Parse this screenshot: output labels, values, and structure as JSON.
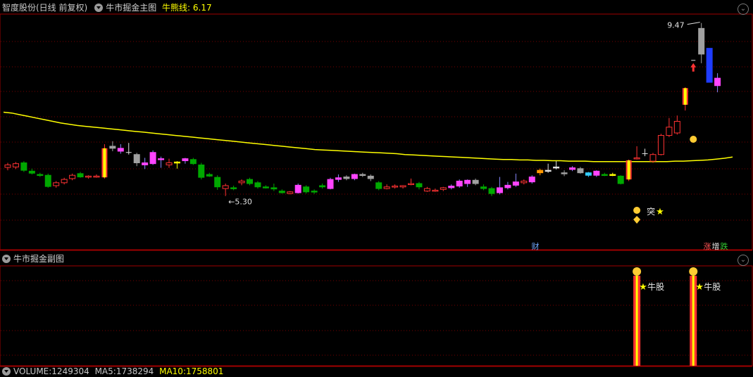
{
  "main": {
    "stock_name": "智度股份(日线 前复权)",
    "indicator_name": "牛市掘金主图",
    "line_label": "牛熊线:",
    "line_value": "6.17",
    "high_label": "9.47",
    "low_label": "5.30",
    "breakout_label": "突",
    "finance_marker": "财",
    "limit_markers": [
      "涨",
      "增",
      "跌"
    ]
  },
  "sub": {
    "indicator_name": "牛市掘金副图",
    "signal_label": "牛股"
  },
  "volume": {
    "label": "VOLUME:",
    "value": "1249304",
    "ma5_label": "MA5:",
    "ma5_value": "1738294",
    "ma10_label": "MA10:",
    "ma10_value": "1758801"
  },
  "colors": {
    "up": "#ff3232",
    "down": "#00a800",
    "magenta": "#ff44ff",
    "gray": "#a0a0a0",
    "line": "#ffff00",
    "accent": "#ffff00"
  },
  "chart_data": {
    "type": "candlestick",
    "price_axis": {
      "min": 4.6,
      "max": 9.6
    },
    "bull_bear_line_value": 6.17,
    "annotated_high": 9.47,
    "annotated_low": 5.3,
    "candles": [
      {
        "o": 5.99,
        "h": 6.1,
        "l": 5.92,
        "c": 6.05,
        "k": "up"
      },
      {
        "o": 6.0,
        "h": 6.12,
        "l": 5.95,
        "c": 6.08,
        "k": "up"
      },
      {
        "o": 6.1,
        "h": 6.14,
        "l": 5.88,
        "c": 5.92,
        "k": "down"
      },
      {
        "o": 5.9,
        "h": 5.96,
        "l": 5.82,
        "c": 5.85,
        "k": "down"
      },
      {
        "o": 5.82,
        "h": 5.86,
        "l": 5.76,
        "c": 5.8,
        "k": "down"
      },
      {
        "o": 5.8,
        "h": 5.84,
        "l": 5.5,
        "c": 5.53,
        "k": "down"
      },
      {
        "o": 5.55,
        "h": 5.66,
        "l": 5.5,
        "c": 5.62,
        "k": "up"
      },
      {
        "o": 5.62,
        "h": 5.74,
        "l": 5.58,
        "c": 5.7,
        "k": "up"
      },
      {
        "o": 5.72,
        "h": 5.84,
        "l": 5.68,
        "c": 5.8,
        "k": "up"
      },
      {
        "o": 5.84,
        "h": 5.88,
        "l": 5.74,
        "c": 5.76,
        "k": "down"
      },
      {
        "o": 5.76,
        "h": 5.8,
        "l": 5.72,
        "c": 5.78,
        "k": "up"
      },
      {
        "o": 5.78,
        "h": 5.82,
        "l": 5.74,
        "c": 5.76,
        "k": "up"
      },
      {
        "o": 5.75,
        "h": 6.55,
        "l": 5.72,
        "c": 6.45,
        "k": "special"
      },
      {
        "o": 6.45,
        "h": 6.62,
        "l": 6.38,
        "c": 6.5,
        "k": "gray"
      },
      {
        "o": 6.45,
        "h": 6.55,
        "l": 6.32,
        "c": 6.38,
        "k": "magenta"
      },
      {
        "o": 6.34,
        "h": 6.58,
        "l": 6.3,
        "c": 6.35,
        "k": "doji"
      },
      {
        "o": 6.3,
        "h": 6.34,
        "l": 6.02,
        "c": 6.1,
        "k": "gray"
      },
      {
        "o": 6.1,
        "h": 6.22,
        "l": 5.95,
        "c": 6.05,
        "k": "magenta"
      },
      {
        "o": 6.35,
        "h": 6.4,
        "l": 6.05,
        "c": 6.08,
        "k": "magenta"
      },
      {
        "o": 6.18,
        "h": 6.25,
        "l": 5.98,
        "c": 6.2,
        "k": "magenta"
      },
      {
        "o": 6.05,
        "h": 6.2,
        "l": 5.98,
        "c": 6.1,
        "k": "up"
      },
      {
        "o": 6.12,
        "h": 6.14,
        "l": 5.96,
        "c": 6.12,
        "k": "yellow"
      },
      {
        "o": 6.15,
        "h": 6.22,
        "l": 6.08,
        "c": 6.2,
        "k": "magenta"
      },
      {
        "o": 6.18,
        "h": 6.22,
        "l": 6.05,
        "c": 6.08,
        "k": "down"
      },
      {
        "o": 6.05,
        "h": 6.1,
        "l": 5.7,
        "c": 5.75,
        "k": "down"
      },
      {
        "o": 5.82,
        "h": 5.86,
        "l": 5.76,
        "c": 5.78,
        "k": "down"
      },
      {
        "o": 5.75,
        "h": 5.8,
        "l": 5.45,
        "c": 5.52,
        "k": "down"
      },
      {
        "o": 5.55,
        "h": 5.6,
        "l": 5.3,
        "c": 5.48,
        "k": "up"
      },
      {
        "o": 5.48,
        "h": 5.55,
        "l": 5.44,
        "c": 5.5,
        "k": "down"
      },
      {
        "o": 5.62,
        "h": 5.7,
        "l": 5.56,
        "c": 5.66,
        "k": "up"
      },
      {
        "o": 5.7,
        "h": 5.74,
        "l": 5.56,
        "c": 5.6,
        "k": "down"
      },
      {
        "o": 5.62,
        "h": 5.66,
        "l": 5.48,
        "c": 5.52,
        "k": "down"
      },
      {
        "o": 5.52,
        "h": 5.56,
        "l": 5.48,
        "c": 5.5,
        "k": "down"
      },
      {
        "o": 5.5,
        "h": 5.6,
        "l": 5.42,
        "c": 5.47,
        "k": "down"
      },
      {
        "o": 5.42,
        "h": 5.46,
        "l": 5.36,
        "c": 5.38,
        "k": "down"
      },
      {
        "o": 5.36,
        "h": 5.42,
        "l": 5.34,
        "c": 5.4,
        "k": "up"
      },
      {
        "o": 5.38,
        "h": 5.6,
        "l": 5.36,
        "c": 5.56,
        "k": "magenta"
      },
      {
        "o": 5.52,
        "h": 5.56,
        "l": 5.36,
        "c": 5.4,
        "k": "down"
      },
      {
        "o": 5.42,
        "h": 5.46,
        "l": 5.35,
        "c": 5.4,
        "k": "down"
      },
      {
        "o": 5.55,
        "h": 5.6,
        "l": 5.48,
        "c": 5.52,
        "k": "down"
      },
      {
        "o": 5.48,
        "h": 5.74,
        "l": 5.46,
        "c": 5.7,
        "k": "magenta"
      },
      {
        "o": 5.7,
        "h": 5.82,
        "l": 5.64,
        "c": 5.74,
        "k": "magenta"
      },
      {
        "o": 5.76,
        "h": 5.8,
        "l": 5.68,
        "c": 5.72,
        "k": "gray"
      },
      {
        "o": 5.72,
        "h": 5.84,
        "l": 5.68,
        "c": 5.82,
        "k": "magenta"
      },
      {
        "o": 5.82,
        "h": 5.86,
        "l": 5.76,
        "c": 5.8,
        "k": "gray"
      },
      {
        "o": 5.78,
        "h": 5.82,
        "l": 5.66,
        "c": 5.72,
        "k": "gray"
      },
      {
        "o": 5.62,
        "h": 5.66,
        "l": 5.44,
        "c": 5.48,
        "k": "down"
      },
      {
        "o": 5.48,
        "h": 5.58,
        "l": 5.46,
        "c": 5.52,
        "k": "up"
      },
      {
        "o": 5.52,
        "h": 5.58,
        "l": 5.48,
        "c": 5.54,
        "k": "up"
      },
      {
        "o": 5.52,
        "h": 5.56,
        "l": 5.48,
        "c": 5.55,
        "k": "up"
      },
      {
        "o": 5.6,
        "h": 5.72,
        "l": 5.56,
        "c": 5.6,
        "k": "up"
      },
      {
        "o": 5.6,
        "h": 5.64,
        "l": 5.46,
        "c": 5.52,
        "k": "down"
      },
      {
        "o": 5.42,
        "h": 5.52,
        "l": 5.4,
        "c": 5.48,
        "k": "up"
      },
      {
        "o": 5.44,
        "h": 5.48,
        "l": 5.4,
        "c": 5.42,
        "k": "up"
      },
      {
        "o": 5.46,
        "h": 5.52,
        "l": 5.42,
        "c": 5.5,
        "k": "up"
      },
      {
        "o": 5.5,
        "h": 5.58,
        "l": 5.46,
        "c": 5.54,
        "k": "magenta"
      },
      {
        "o": 5.54,
        "h": 5.7,
        "l": 5.5,
        "c": 5.66,
        "k": "magenta"
      },
      {
        "o": 5.6,
        "h": 5.7,
        "l": 5.52,
        "c": 5.68,
        "k": "magenta"
      },
      {
        "o": 5.68,
        "h": 5.72,
        "l": 5.56,
        "c": 5.6,
        "k": "gray"
      },
      {
        "o": 5.52,
        "h": 5.58,
        "l": 5.44,
        "c": 5.48,
        "k": "down"
      },
      {
        "o": 5.48,
        "h": 5.52,
        "l": 5.3,
        "c": 5.36,
        "k": "down"
      },
      {
        "o": 5.38,
        "h": 5.76,
        "l": 5.34,
        "c": 5.5,
        "k": "magenta"
      },
      {
        "o": 5.5,
        "h": 5.64,
        "l": 5.46,
        "c": 5.56,
        "k": "magenta"
      },
      {
        "o": 5.56,
        "h": 5.84,
        "l": 5.52,
        "c": 5.64,
        "k": "magenta"
      },
      {
        "o": 5.62,
        "h": 5.7,
        "l": 5.58,
        "c": 5.66,
        "k": "up"
      },
      {
        "o": 5.64,
        "h": 5.8,
        "l": 5.6,
        "c": 5.76,
        "k": "magenta"
      },
      {
        "o": 5.86,
        "h": 5.96,
        "l": 5.8,
        "c": 5.92,
        "k": "orange"
      },
      {
        "o": 5.9,
        "h": 6.08,
        "l": 5.86,
        "c": 5.92,
        "k": "white"
      },
      {
        "o": 5.98,
        "h": 6.14,
        "l": 5.94,
        "c": 6.0,
        "k": "white"
      },
      {
        "o": 5.86,
        "h": 5.92,
        "l": 5.78,
        "c": 5.84,
        "k": "gray"
      },
      {
        "o": 5.94,
        "h": 6.02,
        "l": 5.9,
        "c": 5.98,
        "k": "magenta"
      },
      {
        "o": 5.96,
        "h": 6.0,
        "l": 5.84,
        "c": 5.86,
        "k": "gray"
      },
      {
        "o": 5.86,
        "h": 5.88,
        "l": 5.76,
        "c": 5.8,
        "k": "cyan"
      },
      {
        "o": 5.8,
        "h": 5.92,
        "l": 5.76,
        "c": 5.9,
        "k": "magenta"
      },
      {
        "o": 5.82,
        "h": 5.86,
        "l": 5.78,
        "c": 5.8,
        "k": "down"
      },
      {
        "o": 5.82,
        "h": 5.86,
        "l": 5.78,
        "c": 5.82,
        "k": "yellow"
      },
      {
        "o": 5.78,
        "h": 5.8,
        "l": 5.58,
        "c": 5.6,
        "k": "down"
      },
      {
        "o": 5.7,
        "h": 6.18,
        "l": 5.66,
        "c": 6.16,
        "k": "special"
      },
      {
        "o": 6.2,
        "h": 6.5,
        "l": 6.18,
        "c": 6.22,
        "k": "up"
      },
      {
        "o": 6.3,
        "h": 6.44,
        "l": 6.26,
        "c": 6.32,
        "k": "doji"
      },
      {
        "o": 6.14,
        "h": 6.34,
        "l": 6.1,
        "c": 6.3,
        "k": "up"
      },
      {
        "o": 6.3,
        "h": 6.8,
        "l": 6.28,
        "c": 6.76,
        "k": "up"
      },
      {
        "o": 6.76,
        "h": 7.18,
        "l": 6.72,
        "c": 6.96,
        "k": "up"
      },
      {
        "o": 6.82,
        "h": 7.24,
        "l": 6.78,
        "c": 7.1,
        "k": "up"
      },
      {
        "o": 7.5,
        "h": 7.92,
        "l": 7.36,
        "c": 7.9,
        "k": "special"
      },
      {
        "o": 8.4,
        "h": 8.4,
        "l": 8.4,
        "c": 8.4,
        "k": "arrow"
      },
      {
        "o": 8.72,
        "h": 9.47,
        "l": 8.5,
        "c": 9.34,
        "k": "gray"
      },
      {
        "o": 8.86,
        "h": 8.86,
        "l": 8.04,
        "c": 8.04,
        "k": "blue"
      },
      {
        "o": 8.14,
        "h": 8.26,
        "l": 7.8,
        "c": 7.96,
        "k": "magenta"
      }
    ],
    "bull_bear_line": [
      7.32,
      7.3,
      7.26,
      7.22,
      7.18,
      7.14,
      7.1,
      7.06,
      7.03,
      7.0,
      6.98,
      6.96,
      6.94,
      6.92,
      6.9,
      6.88,
      6.86,
      6.84,
      6.82,
      6.8,
      6.78,
      6.76,
      6.74,
      6.72,
      6.7,
      6.68,
      6.66,
      6.64,
      6.62,
      6.6,
      6.58,
      6.56,
      6.54,
      6.52,
      6.5,
      6.48,
      6.46,
      6.44,
      6.42,
      6.41,
      6.4,
      6.39,
      6.38,
      6.37,
      6.36,
      6.35,
      6.34,
      6.33,
      6.32,
      6.3,
      6.29,
      6.28,
      6.27,
      6.26,
      6.25,
      6.24,
      6.23,
      6.22,
      6.21,
      6.2,
      6.19,
      6.18,
      6.18,
      6.17,
      6.17,
      6.16,
      6.16,
      6.15,
      6.15,
      6.14,
      6.14,
      6.14,
      6.13,
      6.13,
      6.13,
      6.13,
      6.13,
      6.13,
      6.13,
      6.13,
      6.13,
      6.13,
      6.14,
      6.14,
      6.15,
      6.16,
      6.17,
      6.19,
      6.21,
      6.24
    ]
  }
}
